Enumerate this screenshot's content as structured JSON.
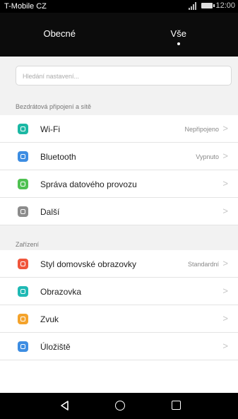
{
  "status_bar": {
    "carrier": "T-Mobile CZ",
    "time": "12:00"
  },
  "tabs": [
    {
      "label": "Obecné",
      "selected": false
    },
    {
      "label": "Vše",
      "selected": true
    }
  ],
  "search": {
    "placeholder": "Hledání nastavení..."
  },
  "sections": [
    {
      "title": "Bezdrátová připojení a sítě"
    },
    {
      "title": "Zařízení"
    }
  ],
  "items": [
    {
      "label": "Wi-Fi",
      "value": "Nepřipojeno",
      "icon": "wifi-icon",
      "color": "#1cb8a4"
    },
    {
      "label": "Bluetooth",
      "value": "Vypnuto",
      "icon": "bluetooth-icon",
      "color": "#3d8de2"
    },
    {
      "label": "Správa datového provozu",
      "value": "",
      "icon": "data-usage-icon",
      "color": "#4fc151"
    },
    {
      "label": "Další",
      "value": "",
      "icon": "more-icon",
      "color": "#8c8c8c"
    },
    {
      "label": "Styl domovské obrazovky",
      "value": "Standardní",
      "icon": "home-style-icon",
      "color": "#f0563c"
    },
    {
      "label": "Obrazovka",
      "value": "",
      "icon": "display-icon",
      "color": "#1fb9b4"
    },
    {
      "label": "Zvuk",
      "value": "",
      "icon": "sound-icon",
      "color": "#f4a32c"
    },
    {
      "label": "Úložiště",
      "value": "",
      "icon": "storage-icon",
      "color": "#3d8de2"
    }
  ],
  "nav_bar": {
    "buttons": [
      "back-icon",
      "home-icon",
      "recent-apps-icon"
    ]
  }
}
